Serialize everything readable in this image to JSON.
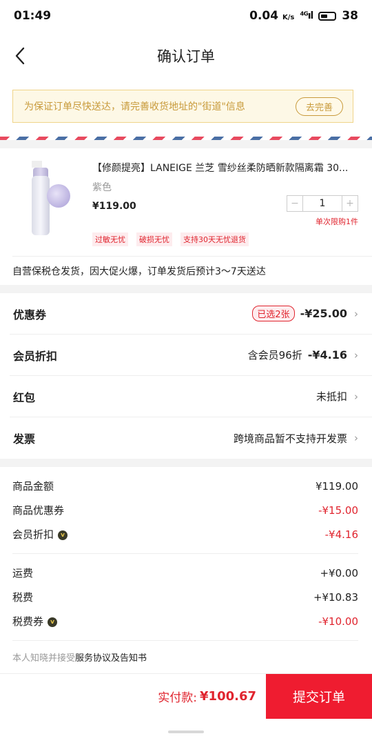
{
  "status_bar": {
    "time": "01:49",
    "speed": "0.04",
    "speed_unit": "K/s",
    "signal": "⁴ᴳıl",
    "battery": "38"
  },
  "nav": {
    "title": "确认订单"
  },
  "notice": {
    "text": "为保证订单尽快送达，请完善收货地址的\"街道\"信息",
    "button": "去完善"
  },
  "product": {
    "name": "【修颜提亮】LANEIGE 兰芝 雪纱丝柔防晒新款隔离霜 30...",
    "variant": "紫色",
    "price": "¥119.00",
    "quantity": "1",
    "limit": "单次限购1件",
    "tags": [
      "过敏无忧",
      "破损无忧",
      "支持30天无忧退货"
    ]
  },
  "delivery_note": "自营保税仓发货，因大促火爆，订单发货后预计3～7天送达",
  "rows": {
    "coupon": {
      "label": "优惠券",
      "badge": "已选2张",
      "amount": "-¥25.00"
    },
    "member": {
      "label": "会员折扣",
      "desc": "含会员96折",
      "amount": "-¥4.16"
    },
    "redpacket": {
      "label": "红包",
      "desc": "未抵扣"
    },
    "invoice": {
      "label": "发票",
      "desc": "跨境商品暂不支持开发票"
    }
  },
  "summary": {
    "goods_amount": {
      "label": "商品金额",
      "value": "¥119.00"
    },
    "goods_coupon": {
      "label": "商品优惠券",
      "value": "-¥15.00"
    },
    "member_discount": {
      "label": "会员折扣",
      "value": "-¥4.16"
    },
    "shipping": {
      "label": "运费",
      "value": "+¥0.00"
    },
    "tax": {
      "label": "税费",
      "value": "+¥10.83"
    },
    "tax_coupon": {
      "label": "税费券",
      "value": "-¥10.00"
    }
  },
  "agreement": {
    "prefix": "本人知晓并接受",
    "link": "服务协议及告知书"
  },
  "bottom": {
    "total_label": "实付款:",
    "total_value": "¥100.67",
    "submit": "提交订单"
  },
  "colors": {
    "accent": "#ef1c30",
    "notice_bg": "#fdf8e6",
    "notice_text": "#c89a3a"
  }
}
